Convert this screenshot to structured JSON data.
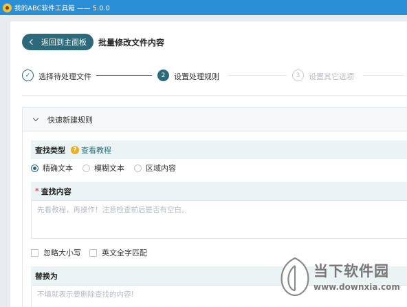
{
  "window": {
    "title": "我的ABC软件工具箱 —— 5.0.0"
  },
  "header": {
    "back_label": "返回到主面板",
    "page_title": "批量修改文件内容"
  },
  "steps": [
    {
      "number": "✓",
      "label": "选择待处理文件",
      "state": "done"
    },
    {
      "number": "2",
      "label": "设置处理规则",
      "state": "active"
    },
    {
      "number": "3",
      "label": "设置其它选项",
      "state": "pending"
    }
  ],
  "panel": {
    "title": "快速新建规则"
  },
  "find_type": {
    "label": "查找类型",
    "help_label": "查看教程",
    "options": [
      "精确文本",
      "模糊文本",
      "区域内容"
    ],
    "selected": "精确文本"
  },
  "find_content": {
    "required_mark": "*",
    "label": "查找内容",
    "placeholder": "先看教程，再操作！注意检查前后是否有空白。"
  },
  "checkboxes": [
    "忽略大小写",
    "英文全字匹配"
  ],
  "replace": {
    "label": "替换为",
    "placeholder": "不填就表示要删除查找的内容!"
  },
  "watermark": {
    "brand": "当下软件园",
    "url": "www.downxia.com"
  },
  "colors": {
    "titlebar": "#2b8fd8",
    "accent": "#2c6a7a",
    "section_bg": "#eaf4f5",
    "help": "#f0ad1a"
  }
}
